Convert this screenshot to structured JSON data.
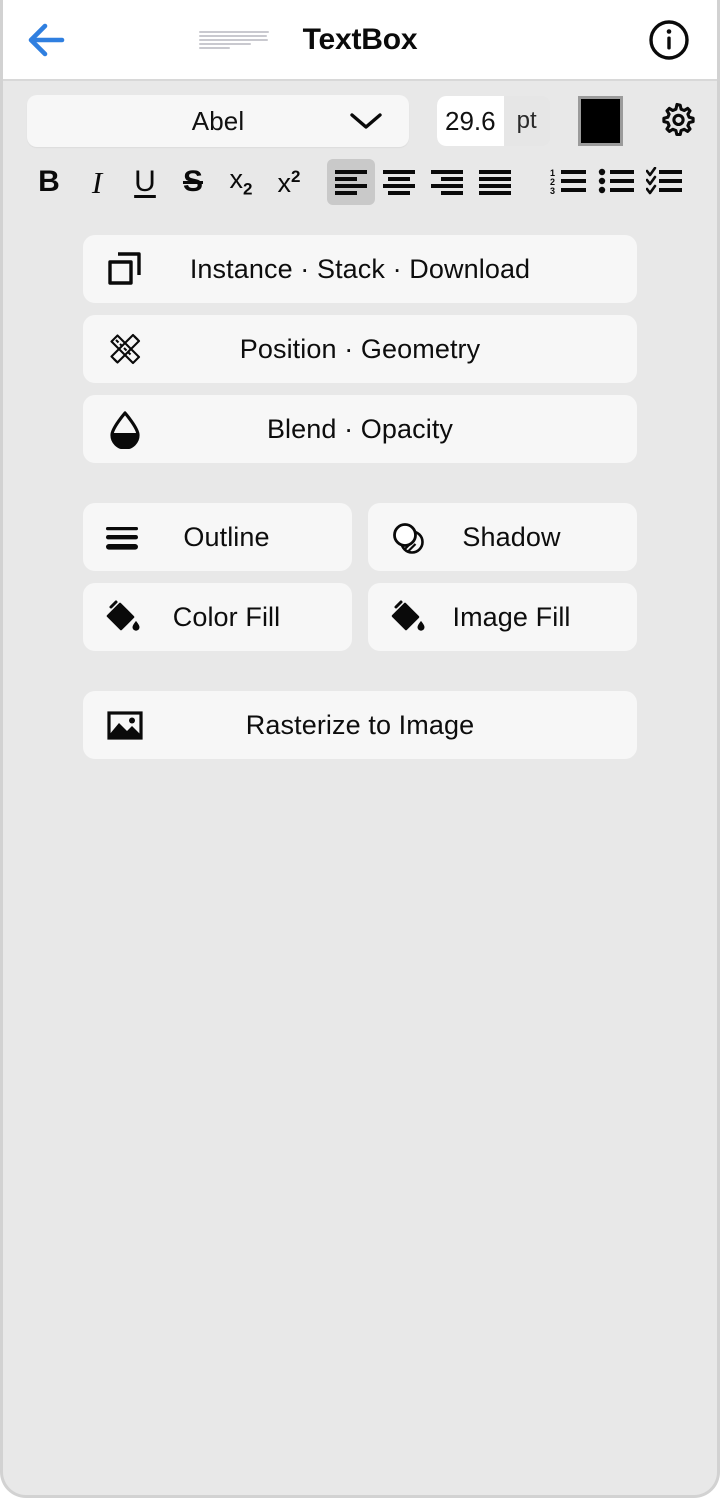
{
  "header": {
    "back_icon": "arrow-left-icon",
    "thumbnail_name": "text-preview-thumbnail",
    "title": "TextBox",
    "info_icon": "info-circle-icon",
    "accent_color": "#2f7fe0"
  },
  "font_row": {
    "font_family_value": "Abel",
    "font_family_chevron": "chevron-down-icon",
    "font_size_value": "29.6",
    "font_size_unit": "pt",
    "font_size_placeholder": "0",
    "text_color": "#000000",
    "settings_icon": "gear-icon"
  },
  "format_toolbar": {
    "items": [
      {
        "name": "bold-button",
        "label": "B",
        "icon": "bold-icon",
        "selected": false
      },
      {
        "name": "italic-button",
        "label": "I",
        "icon": "italic-icon",
        "selected": false
      },
      {
        "name": "underline-button",
        "label": "U",
        "icon": "underline-icon",
        "selected": false
      },
      {
        "name": "strikethrough-button",
        "label": "S",
        "icon": "strikethrough-icon",
        "selected": false
      },
      {
        "name": "subscript-button",
        "label": "x2",
        "icon": "subscript-icon",
        "selected": false
      },
      {
        "name": "superscript-button",
        "label": "x2",
        "icon": "superscript-icon",
        "selected": false
      },
      {
        "name": "align-left-button",
        "label": "",
        "icon": "align-left-icon",
        "selected": true
      },
      {
        "name": "align-center-button",
        "label": "",
        "icon": "align-center-icon",
        "selected": false
      },
      {
        "name": "align-right-button",
        "label": "",
        "icon": "align-right-icon",
        "selected": false
      },
      {
        "name": "align-justify-button",
        "label": "",
        "icon": "align-justify-icon",
        "selected": false
      },
      {
        "name": "numbered-list-button",
        "label": "",
        "icon": "numbered-list-icon",
        "selected": false
      },
      {
        "name": "bulleted-list-button",
        "label": "",
        "icon": "bulleted-list-icon",
        "selected": false
      },
      {
        "name": "checklist-button",
        "label": "",
        "icon": "checklist-icon",
        "selected": false
      }
    ]
  },
  "menu": {
    "cards": [
      {
        "label": "Instance · Stack · Download",
        "icon": "copy-stack-icon"
      },
      {
        "label": "Position · Geometry",
        "icon": "ruler-pencil-icon"
      },
      {
        "label": "Blend · Opacity",
        "icon": "droplet-icon"
      }
    ],
    "grid": [
      {
        "label": "Outline",
        "icon": "outline-lines-icon"
      },
      {
        "label": "Shadow",
        "icon": "shadow-circles-icon"
      },
      {
        "label": "Color Fill",
        "icon": "paint-bucket-icon"
      },
      {
        "label": "Image Fill",
        "icon": "paint-bucket-icon"
      }
    ],
    "footer": [
      {
        "label": "Rasterize to Image",
        "icon": "image-icon"
      }
    ]
  },
  "theme": {
    "page_background": "#e8e8e8",
    "card_background": "#f7f7f7",
    "selected_background": "#c9c9c9",
    "header_background": "#ffffff",
    "text_color": "#0d0d0d"
  }
}
